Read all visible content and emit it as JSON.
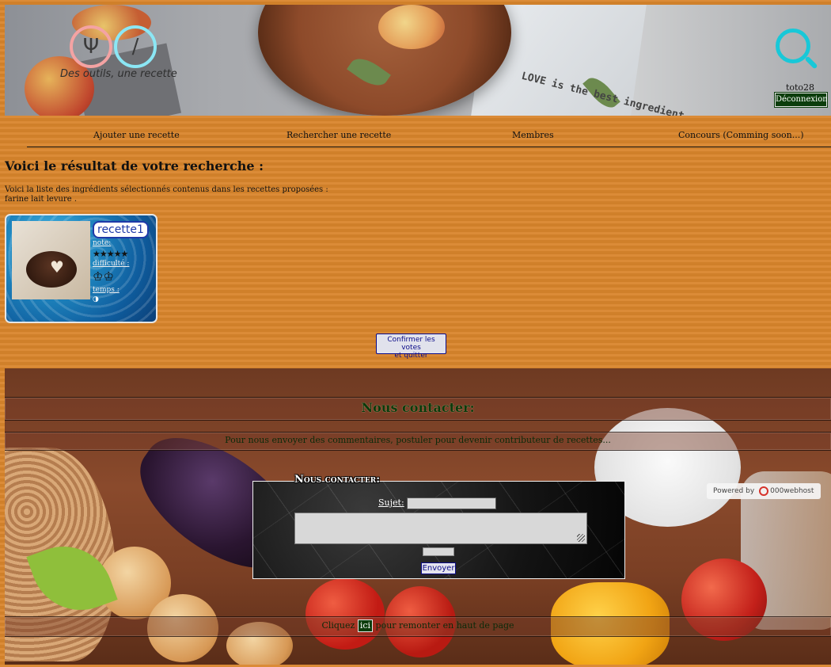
{
  "header": {
    "logo_text": "Des outils, une recette",
    "cloth_text": "LOVE is the best ingredient",
    "username": "toto28",
    "logout_label": "Déconnexion"
  },
  "nav": {
    "items": [
      {
        "label": "Ajouter une recette"
      },
      {
        "label": "Rechercher une recette"
      },
      {
        "label": "Membres"
      },
      {
        "label": "Concours (Comming soon...)"
      }
    ]
  },
  "main": {
    "title": "Voici le résultat de votre recherche :",
    "description_line1": "Voici la liste des ingrédients sélectionnés contenus dans les recettes proposées :",
    "description_line2": "farine lait levure ."
  },
  "recipe_card": {
    "title": "recette1",
    "note_label": "note:",
    "rating_stars": 5,
    "difficulty_label": "difficulté :",
    "difficulty_hats": 2,
    "time_label": "temps :",
    "time_icon": "clock-icon"
  },
  "confirm_button": {
    "line1": "Confirmer les votes",
    "line2": "et quitter"
  },
  "footer": {
    "contact_heading": "Nous contacter:",
    "contact_sub": "Pour nous envoyer des commentaires, postuler pour devenir contributeur de recettes...",
    "form": {
      "title": "Nous contacter:",
      "subject_label": "Sujet:",
      "subject_value": "",
      "message_value": "",
      "send_label": "Envoyer"
    },
    "host_badge": {
      "prefix": "Powered by",
      "name": "000webhost"
    },
    "back_top_before": "Cliquez",
    "back_top_link": "ici",
    "back_top_after": "pour remonter en haut de page"
  },
  "colors": {
    "page_bg": "#d9852c",
    "accent_green": "#0c3d0c",
    "link_blue": "#1e3aa8",
    "search_cyan": "#18c8d8"
  }
}
